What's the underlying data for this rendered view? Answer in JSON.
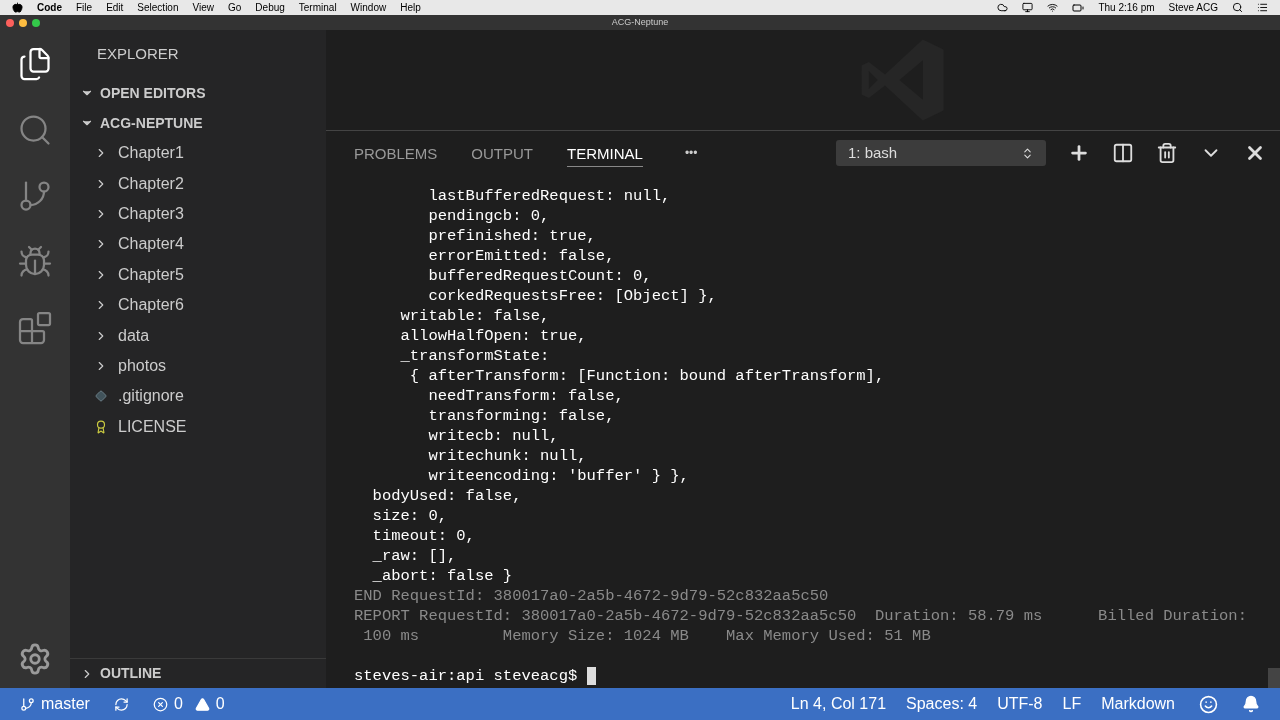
{
  "menu_bar": {
    "app": "Code",
    "items": [
      "File",
      "Edit",
      "Selection",
      "View",
      "Go",
      "Debug",
      "Terminal",
      "Window",
      "Help"
    ],
    "clock": "Thu 2:16 pm",
    "user": "Steve ACG"
  },
  "window": {
    "title": "ACG-Neptune"
  },
  "activity_bar": [
    {
      "kind": "files",
      "selected": true
    },
    {
      "kind": "search",
      "selected": false
    },
    {
      "kind": "scm",
      "selected": false
    },
    {
      "kind": "debug",
      "selected": false
    },
    {
      "kind": "extensions",
      "selected": false
    }
  ],
  "sidebar": {
    "title": "EXPLORER",
    "sections": [
      {
        "label": "OPEN EDITORS",
        "expanded": true
      },
      {
        "label": "ACG-NEPTUNE",
        "expanded": true
      }
    ],
    "items": [
      {
        "label": "Chapter1",
        "kind": "folder"
      },
      {
        "label": "Chapter2",
        "kind": "folder"
      },
      {
        "label": "Chapter3",
        "kind": "folder"
      },
      {
        "label": "Chapter4",
        "kind": "folder"
      },
      {
        "label": "Chapter5",
        "kind": "folder"
      },
      {
        "label": "Chapter6",
        "kind": "folder"
      },
      {
        "label": "data",
        "kind": "folder"
      },
      {
        "label": "photos",
        "kind": "folder"
      },
      {
        "label": ".gitignore",
        "kind": "git"
      },
      {
        "label": "LICENSE",
        "kind": "license"
      }
    ],
    "outline": {
      "label": "OUTLINE",
      "expanded": false
    }
  },
  "panel": {
    "tabs": [
      {
        "label": "PROBLEMS",
        "selected": false
      },
      {
        "label": "OUTPUT",
        "selected": false
      },
      {
        "label": "TERMINAL",
        "selected": true
      }
    ],
    "more": "•••",
    "terminal_select": "1: bash",
    "lines": [
      {
        "kind": "output",
        "text": "        lastBufferedRequest: null,"
      },
      {
        "kind": "output",
        "text": "        pendingcb: 0,"
      },
      {
        "kind": "output",
        "text": "        prefinished: true,"
      },
      {
        "kind": "output",
        "text": "        errorEmitted: false,"
      },
      {
        "kind": "output",
        "text": "        bufferedRequestCount: 0,"
      },
      {
        "kind": "output",
        "text": "        corkedRequestsFree: [Object] },"
      },
      {
        "kind": "output",
        "text": "     writable: false,"
      },
      {
        "kind": "output",
        "text": "     allowHalfOpen: true,"
      },
      {
        "kind": "output",
        "text": "     _transformState:"
      },
      {
        "kind": "output",
        "text": "      { afterTransform: [Function: bound afterTransform],"
      },
      {
        "kind": "output",
        "text": "        needTransform: false,"
      },
      {
        "kind": "output",
        "text": "        transforming: false,"
      },
      {
        "kind": "output",
        "text": "        writecb: null,"
      },
      {
        "kind": "output",
        "text": "        writechunk: null,"
      },
      {
        "kind": "output",
        "text": "        writeencoding: 'buffer' } },"
      },
      {
        "kind": "output",
        "text": "  bodyUsed: false,"
      },
      {
        "kind": "output",
        "text": "  size: 0,"
      },
      {
        "kind": "output",
        "text": "  timeout: 0,"
      },
      {
        "kind": "output",
        "text": "  _raw: [],"
      },
      {
        "kind": "output",
        "text": "  _abort: false }"
      },
      {
        "kind": "log",
        "text": "END RequestId: 380017a0-2a5b-4672-9d79-52c832aa5c50"
      },
      {
        "kind": "log",
        "text": "REPORT RequestId: 380017a0-2a5b-4672-9d79-52c832aa5c50  Duration: 58.79 ms      Billed Duration:"
      },
      {
        "kind": "log",
        "text": " 100 ms         Memory Size: 1024 MB    Max Memory Used: 51 MB"
      },
      {
        "kind": "blank"
      },
      {
        "kind": "prompt",
        "text": "steves-air:api steveacg$ "
      }
    ]
  },
  "status_bar": {
    "branch": "master",
    "errors": "0",
    "warnings": "0",
    "right": [
      "Ln 4, Col 171",
      "Spaces: 4",
      "UTF-8",
      "LF",
      "Markdown"
    ]
  }
}
